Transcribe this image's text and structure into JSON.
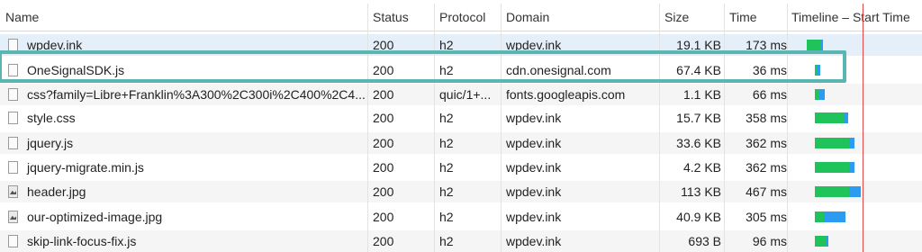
{
  "columns": {
    "name": "Name",
    "status": "Status",
    "protocol": "Protocol",
    "domain": "Domain",
    "size": "Size",
    "time": "Time",
    "timeline": "Timeline – Start Time"
  },
  "colors": {
    "selected_row": "#e5effa",
    "stripe_row": "#f5f5f5",
    "waiting": "#1fc35a",
    "receiving": "#2b9cf0",
    "highlight_border": "#5ab6b3",
    "marker_line": "#e04848"
  },
  "requests": [
    {
      "name": "wpdev.ink",
      "status": "200",
      "protocol": "h2",
      "domain": "wpdev.ink",
      "size": "19.1 KB",
      "time": "173 ms",
      "icon": "document-icon",
      "selected": true
    },
    {
      "name": "OneSignalSDK.js",
      "status": "200",
      "protocol": "h2",
      "domain": "cdn.onesignal.com",
      "size": "67.4 KB",
      "time": "36 ms",
      "icon": "document-icon",
      "highlighted": true
    },
    {
      "name": "css?family=Libre+Franklin%3A300%2C300i%2C400%2C4...",
      "status": "200",
      "protocol": "quic/1+...",
      "domain": "fonts.googleapis.com",
      "size": "1.1 KB",
      "time": "66 ms",
      "icon": "document-icon"
    },
    {
      "name": "style.css",
      "status": "200",
      "protocol": "h2",
      "domain": "wpdev.ink",
      "size": "15.7 KB",
      "time": "358 ms",
      "icon": "document-icon"
    },
    {
      "name": "jquery.js",
      "status": "200",
      "protocol": "h2",
      "domain": "wpdev.ink",
      "size": "33.6 KB",
      "time": "362 ms",
      "icon": "document-icon"
    },
    {
      "name": "jquery-migrate.min.js",
      "status": "200",
      "protocol": "h2",
      "domain": "wpdev.ink",
      "size": "4.2 KB",
      "time": "362 ms",
      "icon": "document-icon"
    },
    {
      "name": "header.jpg",
      "status": "200",
      "protocol": "h2",
      "domain": "wpdev.ink",
      "size": "113 KB",
      "time": "467 ms",
      "icon": "image-icon"
    },
    {
      "name": "our-optimized-image.jpg",
      "status": "200",
      "protocol": "h2",
      "domain": "wpdev.ink",
      "size": "40.9 KB",
      "time": "305 ms",
      "icon": "image-icon"
    },
    {
      "name": "skip-link-focus-fix.js",
      "status": "200",
      "protocol": "h2",
      "domain": "wpdev.ink",
      "size": "693 B",
      "time": "96 ms",
      "icon": "document-icon"
    }
  ]
}
